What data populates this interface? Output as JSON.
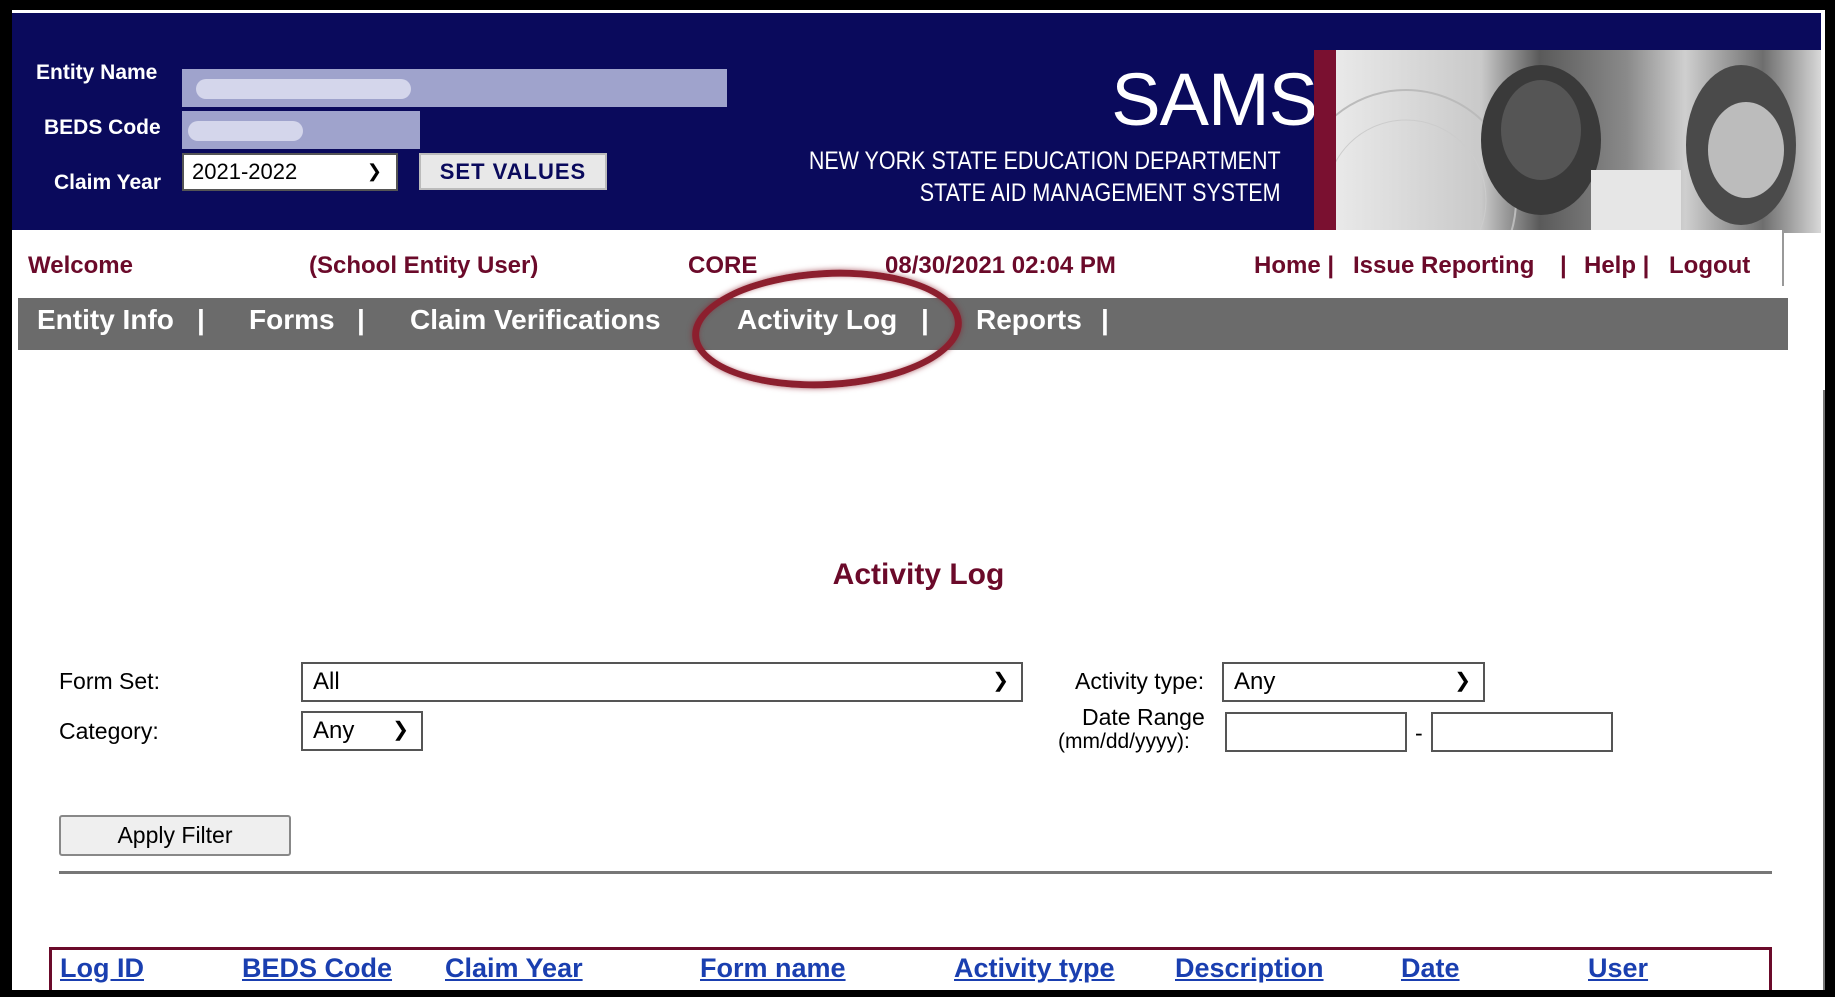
{
  "header": {
    "entity_name_label": "Entity Name",
    "beds_code_label": "BEDS Code",
    "claim_year_label": "Claim Year",
    "claim_year_value": "2021-2022",
    "set_values_label": "SET VALUES",
    "app_title": "SAMS",
    "dept_line1": "NEW YORK STATE EDUCATION DEPARTMENT",
    "dept_line2": "STATE AID MANAGEMENT SYSTEM"
  },
  "welcome_bar": {
    "welcome": "Welcome",
    "role": "(School Entity User)",
    "core": "CORE",
    "datetime": "08/30/2021 02:04 PM",
    "links": [
      "Home |",
      "Issue Reporting",
      "|",
      "Help |",
      "Logout"
    ]
  },
  "nav": {
    "items": [
      "Entity Info",
      "|",
      "Forms",
      "|",
      "Claim Verifications",
      "Activity Log",
      "|",
      "Reports",
      "|"
    ]
  },
  "page": {
    "title": "Activity Log",
    "form_set_label": "Form Set:",
    "form_set_value": "All",
    "category_label": "Category:",
    "category_value": "Any",
    "activity_type_label": "Activity type:",
    "activity_type_value": "Any",
    "date_range_label": "Date Range",
    "date_format_label": "(mm/dd/yyyy):",
    "date_sep": "-",
    "apply_filter_label": "Apply Filter"
  },
  "table": {
    "columns": [
      "Log ID",
      "BEDS Code",
      "Claim Year",
      "Form name",
      "Activity type",
      "Description",
      "Date",
      "User"
    ]
  },
  "colors": {
    "header_bg": "#0a0a5c",
    "nav_bg": "#6b6b6b",
    "accent_maroon": "#6b0a2a",
    "link_blue": "#1a3fb0",
    "highlight_ring": "#8c1f2e"
  }
}
